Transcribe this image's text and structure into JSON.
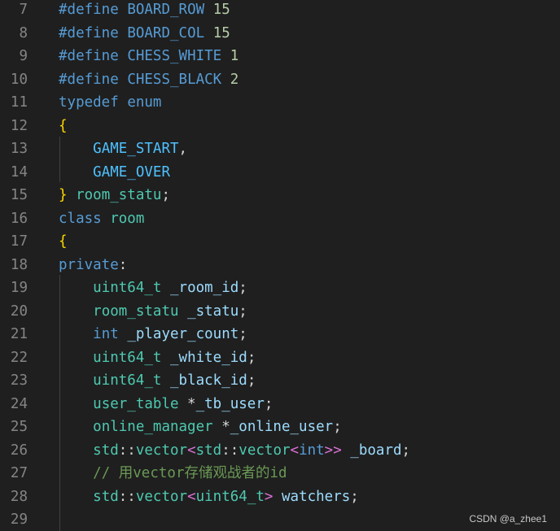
{
  "colors": {
    "background": "#1f1f1f",
    "line_number": "#858585",
    "keyword": "#569cd6",
    "macro": "#569cd6",
    "constant": "#4fc1ff",
    "number": "#b5cea8",
    "type": "#4ec9b0",
    "variable": "#9cdcfe",
    "punctuation": "#d4d4d4",
    "bracket": "#ffd700",
    "angle_bracket": "#da70d6",
    "comment": "#6a9955"
  },
  "editor": {
    "lines": [
      {
        "number": "7",
        "tokens": [
          {
            "text": "#define",
            "kind": "keyword"
          },
          {
            "text": " ",
            "kind": "punctuation"
          },
          {
            "text": "BOARD_ROW",
            "kind": "macro"
          },
          {
            "text": " ",
            "kind": "punctuation"
          },
          {
            "text": "15",
            "kind": "number"
          }
        ]
      },
      {
        "number": "8",
        "tokens": [
          {
            "text": "#define",
            "kind": "keyword"
          },
          {
            "text": " ",
            "kind": "punctuation"
          },
          {
            "text": "BOARD_COL",
            "kind": "macro"
          },
          {
            "text": " ",
            "kind": "punctuation"
          },
          {
            "text": "15",
            "kind": "number"
          }
        ]
      },
      {
        "number": "9",
        "tokens": [
          {
            "text": "#define",
            "kind": "keyword"
          },
          {
            "text": " ",
            "kind": "punctuation"
          },
          {
            "text": "CHESS_WHITE",
            "kind": "macro"
          },
          {
            "text": " ",
            "kind": "punctuation"
          },
          {
            "text": "1",
            "kind": "number"
          }
        ]
      },
      {
        "number": "10",
        "tokens": [
          {
            "text": "#define",
            "kind": "keyword"
          },
          {
            "text": " ",
            "kind": "punctuation"
          },
          {
            "text": "CHESS_BLACK",
            "kind": "macro"
          },
          {
            "text": " ",
            "kind": "punctuation"
          },
          {
            "text": "2",
            "kind": "number"
          }
        ]
      },
      {
        "number": "11",
        "tokens": [
          {
            "text": "typedef",
            "kind": "keyword"
          },
          {
            "text": " ",
            "kind": "punctuation"
          },
          {
            "text": "enum",
            "kind": "keyword"
          }
        ]
      },
      {
        "number": "12",
        "tokens": [
          {
            "text": "{",
            "kind": "bracket"
          }
        ]
      },
      {
        "number": "13",
        "tokens": [
          {
            "text": "    ",
            "kind": "punctuation"
          },
          {
            "text": "GAME_START",
            "kind": "constant"
          },
          {
            "text": ",",
            "kind": "punctuation"
          }
        ]
      },
      {
        "number": "14",
        "tokens": [
          {
            "text": "    ",
            "kind": "punctuation"
          },
          {
            "text": "GAME_OVER",
            "kind": "constant"
          }
        ]
      },
      {
        "number": "15",
        "tokens": [
          {
            "text": "}",
            "kind": "bracket"
          },
          {
            "text": " ",
            "kind": "punctuation"
          },
          {
            "text": "room_statu",
            "kind": "type"
          },
          {
            "text": ";",
            "kind": "punctuation"
          }
        ]
      },
      {
        "number": "16",
        "tokens": [
          {
            "text": "class",
            "kind": "keyword"
          },
          {
            "text": " ",
            "kind": "punctuation"
          },
          {
            "text": "room",
            "kind": "type"
          }
        ]
      },
      {
        "number": "17",
        "tokens": [
          {
            "text": "{",
            "kind": "bracket"
          }
        ]
      },
      {
        "number": "18",
        "tokens": [
          {
            "text": "private",
            "kind": "keyword"
          },
          {
            "text": ":",
            "kind": "punctuation"
          }
        ]
      },
      {
        "number": "19",
        "tokens": [
          {
            "text": "    ",
            "kind": "punctuation"
          },
          {
            "text": "uint64_t",
            "kind": "type"
          },
          {
            "text": " ",
            "kind": "punctuation"
          },
          {
            "text": "_room_id",
            "kind": "variable"
          },
          {
            "text": ";",
            "kind": "punctuation"
          }
        ]
      },
      {
        "number": "20",
        "tokens": [
          {
            "text": "    ",
            "kind": "punctuation"
          },
          {
            "text": "room_statu",
            "kind": "type"
          },
          {
            "text": " ",
            "kind": "punctuation"
          },
          {
            "text": "_statu",
            "kind": "variable"
          },
          {
            "text": ";",
            "kind": "punctuation"
          }
        ]
      },
      {
        "number": "21",
        "tokens": [
          {
            "text": "    ",
            "kind": "punctuation"
          },
          {
            "text": "int",
            "kind": "keyword"
          },
          {
            "text": " ",
            "kind": "punctuation"
          },
          {
            "text": "_player_count",
            "kind": "variable"
          },
          {
            "text": ";",
            "kind": "punctuation"
          }
        ]
      },
      {
        "number": "22",
        "tokens": [
          {
            "text": "    ",
            "kind": "punctuation"
          },
          {
            "text": "uint64_t",
            "kind": "type"
          },
          {
            "text": " ",
            "kind": "punctuation"
          },
          {
            "text": "_white_id",
            "kind": "variable"
          },
          {
            "text": ";",
            "kind": "punctuation"
          }
        ]
      },
      {
        "number": "23",
        "tokens": [
          {
            "text": "    ",
            "kind": "punctuation"
          },
          {
            "text": "uint64_t",
            "kind": "type"
          },
          {
            "text": " ",
            "kind": "punctuation"
          },
          {
            "text": "_black_id",
            "kind": "variable"
          },
          {
            "text": ";",
            "kind": "punctuation"
          }
        ]
      },
      {
        "number": "24",
        "tokens": [
          {
            "text": "    ",
            "kind": "punctuation"
          },
          {
            "text": "user_table",
            "kind": "type"
          },
          {
            "text": " *",
            "kind": "punctuation"
          },
          {
            "text": "_tb_user",
            "kind": "variable"
          },
          {
            "text": ";",
            "kind": "punctuation"
          }
        ]
      },
      {
        "number": "25",
        "tokens": [
          {
            "text": "    ",
            "kind": "punctuation"
          },
          {
            "text": "online_manager",
            "kind": "type"
          },
          {
            "text": " *",
            "kind": "punctuation"
          },
          {
            "text": "_online_user",
            "kind": "variable"
          },
          {
            "text": ";",
            "kind": "punctuation"
          }
        ]
      },
      {
        "number": "26",
        "tokens": [
          {
            "text": "    ",
            "kind": "punctuation"
          },
          {
            "text": "std",
            "kind": "type"
          },
          {
            "text": "::",
            "kind": "punctuation"
          },
          {
            "text": "vector",
            "kind": "type"
          },
          {
            "text": "<",
            "kind": "angle_bracket"
          },
          {
            "text": "std",
            "kind": "type"
          },
          {
            "text": "::",
            "kind": "punctuation"
          },
          {
            "text": "vector",
            "kind": "type"
          },
          {
            "text": "<",
            "kind": "angle_bracket"
          },
          {
            "text": "int",
            "kind": "keyword"
          },
          {
            "text": ">>",
            "kind": "angle_bracket"
          },
          {
            "text": " ",
            "kind": "punctuation"
          },
          {
            "text": "_board",
            "kind": "variable"
          },
          {
            "text": ";",
            "kind": "punctuation"
          }
        ]
      },
      {
        "number": "27",
        "tokens": [
          {
            "text": "    ",
            "kind": "punctuation"
          },
          {
            "text": "// 用vector存储观战者的id",
            "kind": "comment"
          }
        ]
      },
      {
        "number": "28",
        "tokens": [
          {
            "text": "    ",
            "kind": "punctuation"
          },
          {
            "text": "std",
            "kind": "type"
          },
          {
            "text": "::",
            "kind": "punctuation"
          },
          {
            "text": "vector",
            "kind": "type"
          },
          {
            "text": "<",
            "kind": "angle_bracket"
          },
          {
            "text": "uint64_t",
            "kind": "type"
          },
          {
            "text": ">",
            "kind": "angle_bracket"
          },
          {
            "text": " ",
            "kind": "punctuation"
          },
          {
            "text": "watchers",
            "kind": "variable"
          },
          {
            "text": ";",
            "kind": "punctuation"
          }
        ]
      },
      {
        "number": "29",
        "tokens": []
      }
    ]
  },
  "watermark": "CSDN @a_zhee1"
}
